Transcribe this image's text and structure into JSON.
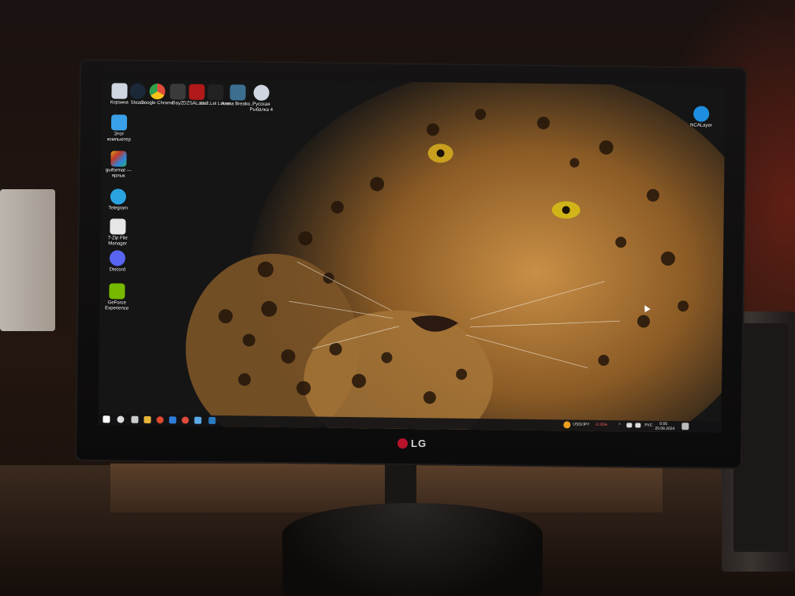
{
  "desktop_icons_left": [
    {
      "label": "Корзина",
      "icon": "recycle-bin-icon",
      "color": "#cfd6e0"
    },
    {
      "label": "Steam",
      "icon": "steam-icon",
      "color": "#1b2838"
    },
    {
      "label": "Google Chrome",
      "icon": "chrome-icon",
      "color": "#e14b3b"
    },
    {
      "label": "DayZ",
      "icon": "dayz-icon",
      "color": "#3a3a3a"
    },
    {
      "label": "DZSALaun...",
      "icon": "dzsa-launcher-icon",
      "color": "#b01919"
    },
    {
      "label": "Hell Let Loose",
      "icon": "hell-let-loose-icon",
      "color": "#222222"
    },
    {
      "label": "Arena Breako...",
      "icon": "arena-breakout-icon",
      "color": "#3b6e8f"
    },
    {
      "label": "Русская Рыбалка 4",
      "icon": "russian-fishing-icon",
      "color": "#cfd6e0"
    }
  ],
  "desktop_icons_column": [
    {
      "label": "Этот компьютер",
      "icon": "this-pc-icon",
      "color": "#3aa0e8"
    },
    {
      "label": "guiformat — ярлык",
      "icon": "guiformat-icon",
      "color": "#d6a21c"
    },
    {
      "label": "Telegram",
      "icon": "telegram-icon",
      "color": "#2aa3e0"
    },
    {
      "label": "7-Zip File Manager",
      "icon": "seven-zip-icon",
      "color": "#e6e6e6"
    },
    {
      "label": "Discord",
      "icon": "discord-icon",
      "color": "#5865f2"
    },
    {
      "label": "GeForce Experience",
      "icon": "geforce-icon",
      "color": "#76b900"
    }
  ],
  "desktop_icon_right": {
    "label": "NCALayer",
    "icon": "ncalayer-icon",
    "color": "#1e8fe0"
  },
  "taskbar": {
    "pinned": [
      {
        "icon": "start-windows-icon",
        "color": "#ffffff"
      },
      {
        "icon": "search-icon",
        "color": "#ffffff"
      },
      {
        "icon": "task-view-icon",
        "color": "#ffffff"
      },
      {
        "icon": "explorer-icon",
        "color": "#e7b53a"
      },
      {
        "icon": "browser-icon",
        "color": "#e04a2c"
      },
      {
        "icon": "store-icon",
        "color": "#2f7fd8"
      },
      {
        "icon": "chrome-icon",
        "color": "#e14b3b"
      },
      {
        "icon": "app-icon",
        "color": "#5aa9e6"
      },
      {
        "icon": "app-icon-2",
        "color": "#2b7bbd"
      }
    ],
    "ticker_label": "USD/JPY",
    "ticker_change": "-0.35%",
    "language": "РУС",
    "clock_time": "0:00",
    "clock_date": "20.09.2024"
  },
  "monitor_brand": "LG",
  "colors": {
    "ticker_negative": "#ff5a5a",
    "brand_red": "#b8132b"
  }
}
